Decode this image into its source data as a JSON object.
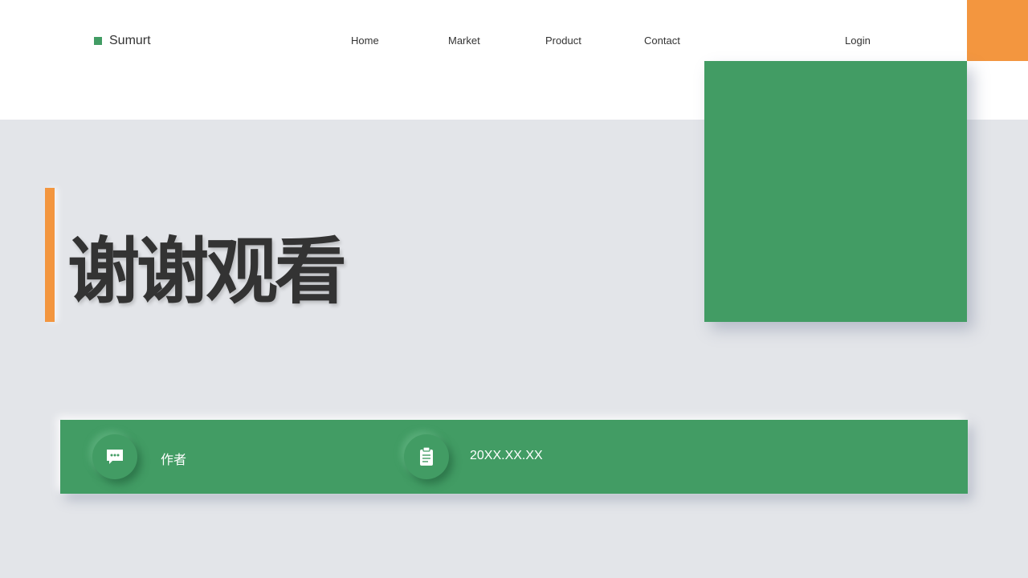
{
  "header": {
    "brand": "Sumurt",
    "nav": [
      "Home",
      "Market",
      "Product",
      "Contact"
    ],
    "login_label": "Login"
  },
  "hero": {
    "title": "谢谢观看"
  },
  "info_bar": {
    "author_label": "作者",
    "author_icon": "chat-bubble-icon",
    "date_label": "20XX.XX.XX",
    "date_icon": "clipboard-icon"
  },
  "colors": {
    "green": "#429c64",
    "orange": "#f3963f",
    "background": "#e3e5e9",
    "header_bg": "#ffffff",
    "text": "#333333"
  }
}
